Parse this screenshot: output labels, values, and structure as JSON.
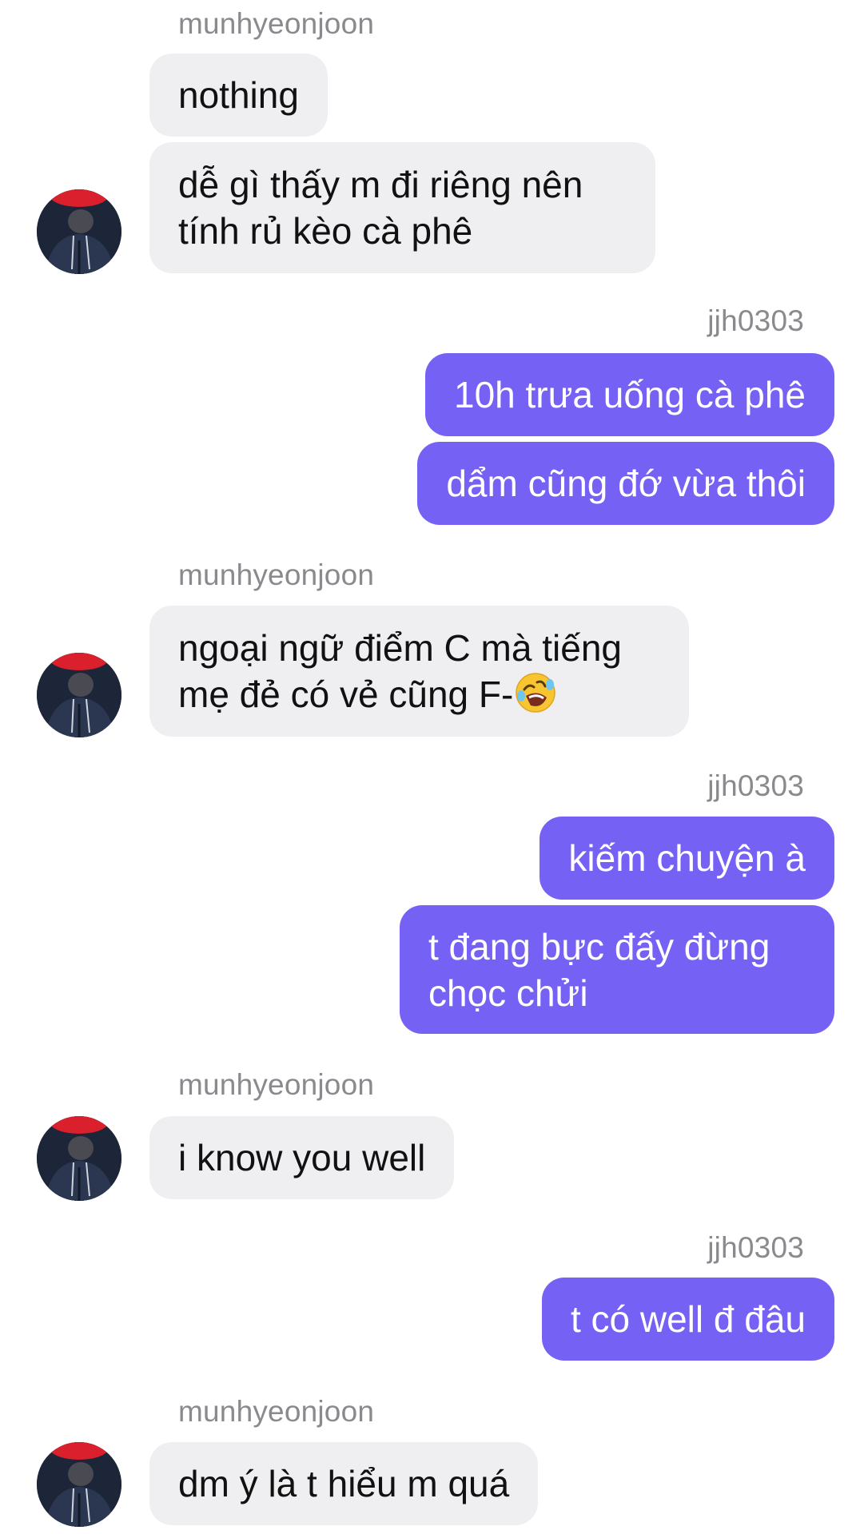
{
  "conversation": {
    "peer_name": "munhyeonjoon",
    "self_name": "jjh0303",
    "groups": [
      {
        "from": "peer",
        "sender": "munhyeonjoon",
        "messages": [
          "nothing",
          "dễ gì thấy m đi riêng nên tính rủ kèo cà phê"
        ]
      },
      {
        "from": "self",
        "sender": "jjh0303",
        "messages": [
          "10h trưa uống cà phê",
          "dẩm cũng đớ vừa thôi"
        ]
      },
      {
        "from": "peer",
        "sender": "munhyeonjoon",
        "messages": [
          "ngoại ngữ điểm C mà tiếng mẹ đẻ có vẻ cũng F-"
        ],
        "emoji": "rolling-on-floor-laughing"
      },
      {
        "from": "self",
        "sender": "jjh0303",
        "messages": [
          "kiếm chuyện à",
          "t đang bực đấy đừng chọc chửi"
        ]
      },
      {
        "from": "peer",
        "sender": "munhyeonjoon",
        "messages": [
          "i know you well"
        ]
      },
      {
        "from": "self",
        "sender": "jjh0303",
        "messages": [
          "t có well đ đâu"
        ]
      },
      {
        "from": "peer",
        "sender": "munhyeonjoon",
        "messages": [
          "dm ý là t hiểu m quá"
        ]
      }
    ]
  },
  "colors": {
    "outgoing_bubble": "#7661f5",
    "incoming_bubble": "#efeff1",
    "sender_label": "#8a8a8e",
    "background": "#ffffff"
  }
}
